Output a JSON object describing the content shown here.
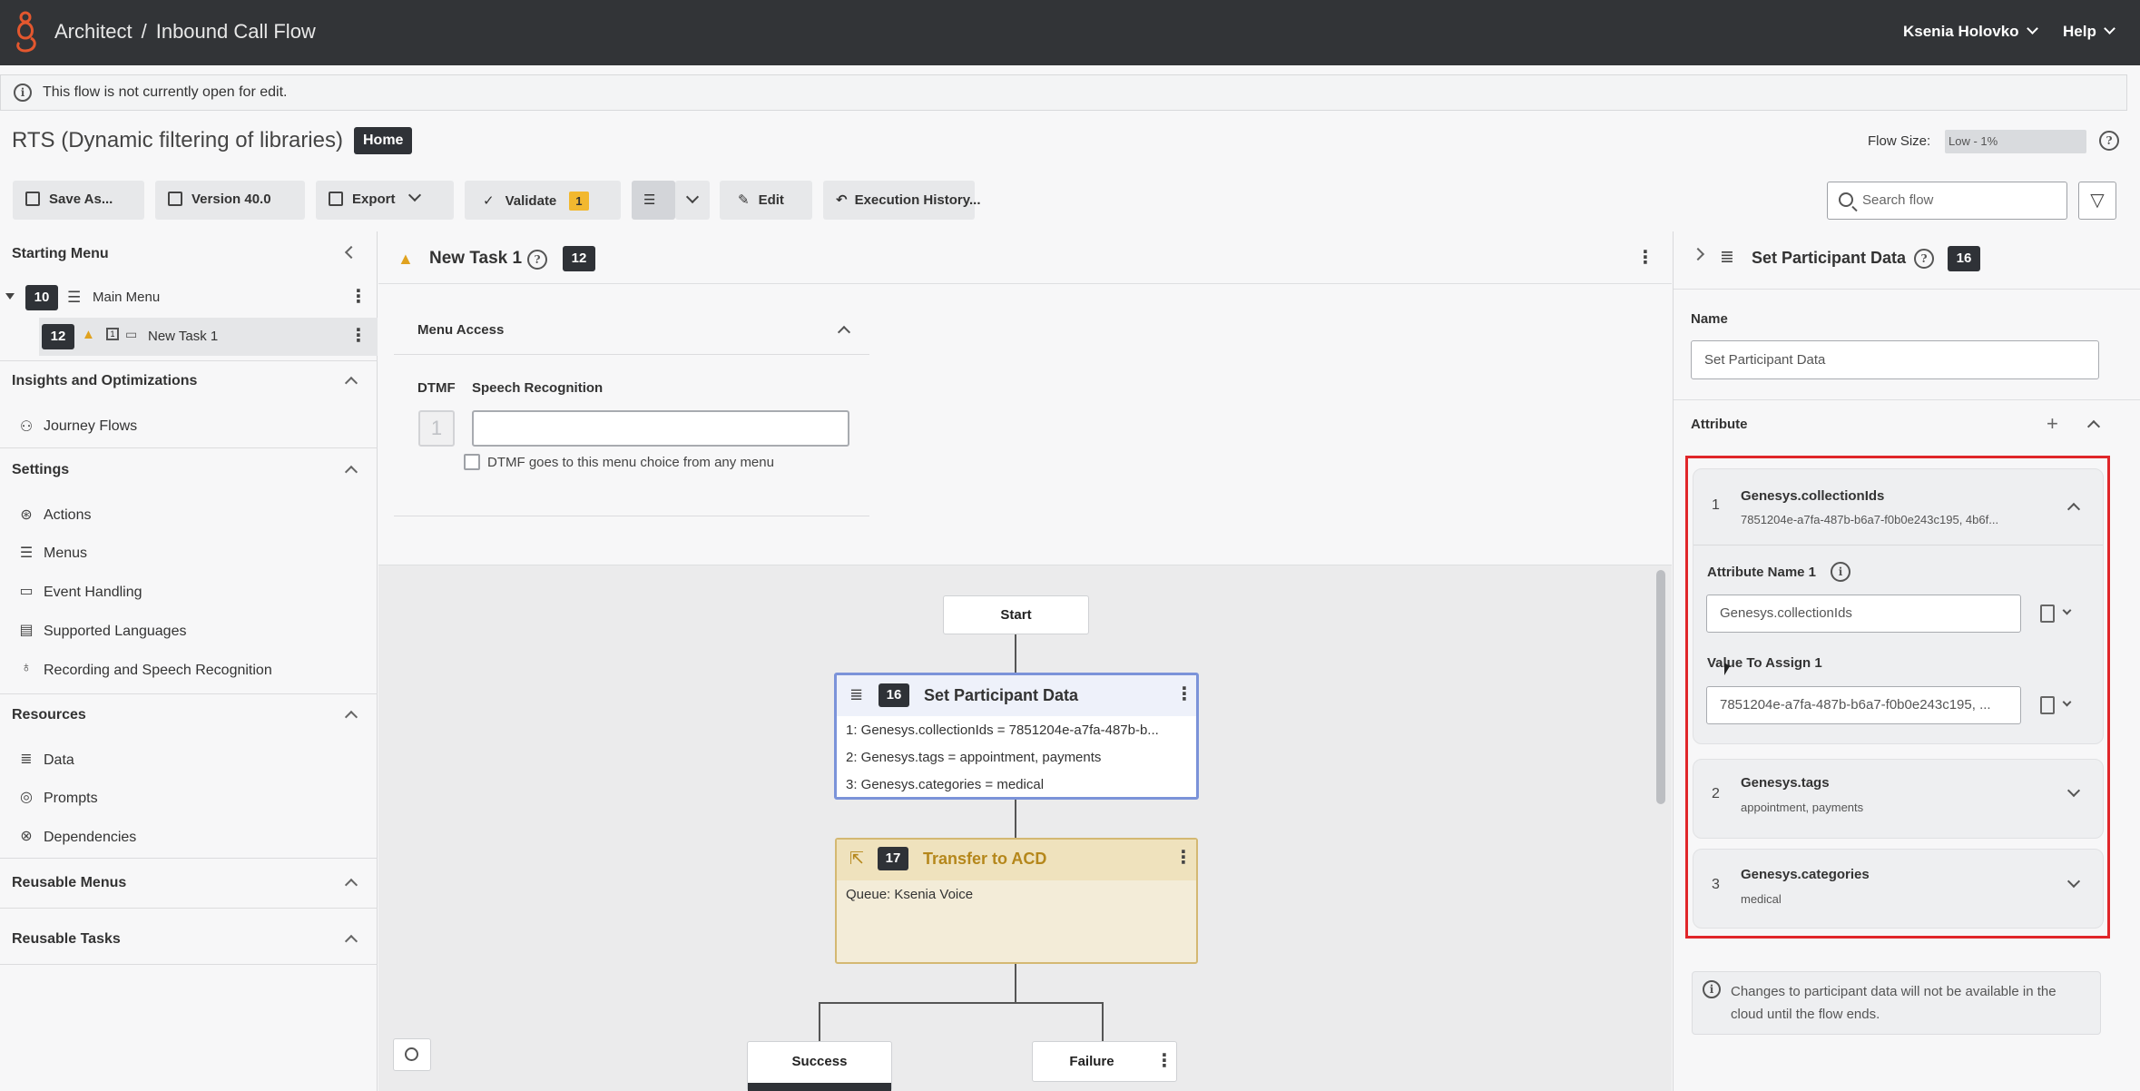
{
  "topbar": {
    "app": "Architect",
    "separator": "/",
    "flow_type": "Inbound Call Flow",
    "user": "Ksenia Holovko",
    "help": "Help"
  },
  "infobar": {
    "message": "This flow is not currently open for edit."
  },
  "flow": {
    "title": "RTS (Dynamic filtering of libraries)",
    "badge": "Home",
    "size_label": "Flow Size:",
    "size_value": "Low - 1%"
  },
  "toolbar": {
    "save_as": "Save As...",
    "version": "Version 40.0",
    "export": "Export",
    "validate": "Validate",
    "validate_count": "1",
    "edit": "Edit",
    "execution_history": "Execution History...",
    "search_placeholder": "Search flow"
  },
  "left": {
    "starting_menu": "Starting Menu",
    "tree": [
      {
        "id": "10",
        "label": "Main Menu"
      },
      {
        "id": "12",
        "label": "New Task 1"
      }
    ],
    "insights": {
      "title": "Insights and Optimizations",
      "items": [
        "Journey Flows"
      ]
    },
    "settings": {
      "title": "Settings",
      "items": [
        "Actions",
        "Menus",
        "Event Handling",
        "Supported Languages",
        "Recording and Speech Recognition"
      ]
    },
    "resources": {
      "title": "Resources",
      "items": [
        "Data",
        "Prompts",
        "Dependencies"
      ]
    },
    "reusable_menus": "Reusable Menus",
    "reusable_tasks": "Reusable Tasks"
  },
  "task": {
    "title": "New Task 1",
    "id": "12",
    "menu_access": "Menu Access",
    "dtmf_label": "DTMF",
    "speech_label": "Speech Recognition",
    "dtmf_value": "1",
    "speech_value": "",
    "checkbox_label": "DTMF goes to this menu choice from any menu"
  },
  "canvas": {
    "start": "Start",
    "set_node": {
      "id": "16",
      "title": "Set Participant Data",
      "lines": [
        "1: Genesys.collectionIds = 7851204e-a7fa-487b-b...",
        "2: Genesys.tags = appointment, payments",
        "3: Genesys.categories = medical"
      ]
    },
    "transfer_node": {
      "id": "17",
      "title": "Transfer to ACD",
      "queue": "Queue: Ksenia Voice"
    },
    "success": "Success",
    "failure": "Failure"
  },
  "right": {
    "title": "Set Participant Data",
    "id": "16",
    "name_label": "Name",
    "name_value": "Set Participant Data",
    "attribute_label": "Attribute",
    "attributes": [
      {
        "num": "1",
        "name": "Genesys.collectionIds",
        "value_short": "7851204e-a7fa-487b-b6a7-f0b0e243c195, 4b6f...",
        "attr_name_label": "Attribute Name 1",
        "attr_name_value": "Genesys.collectionIds",
        "value_label": "Value To Assign 1",
        "value_field": "7851204e-a7fa-487b-b6a7-f0b0e243c195, ..."
      },
      {
        "num": "2",
        "name": "Genesys.tags",
        "value_short": "appointment, payments"
      },
      {
        "num": "3",
        "name": "Genesys.categories",
        "value_short": "medical"
      }
    ],
    "note": "Changes to participant data will not be available in the cloud until the flow ends."
  },
  "colors": {
    "topbar": "#323437",
    "brand_orange": "#e4572e",
    "warn": "#f2b82f",
    "highlight_red": "#e0262a",
    "set_node_border": "#7b93d9",
    "transfer_node_title": "#b5871b"
  }
}
